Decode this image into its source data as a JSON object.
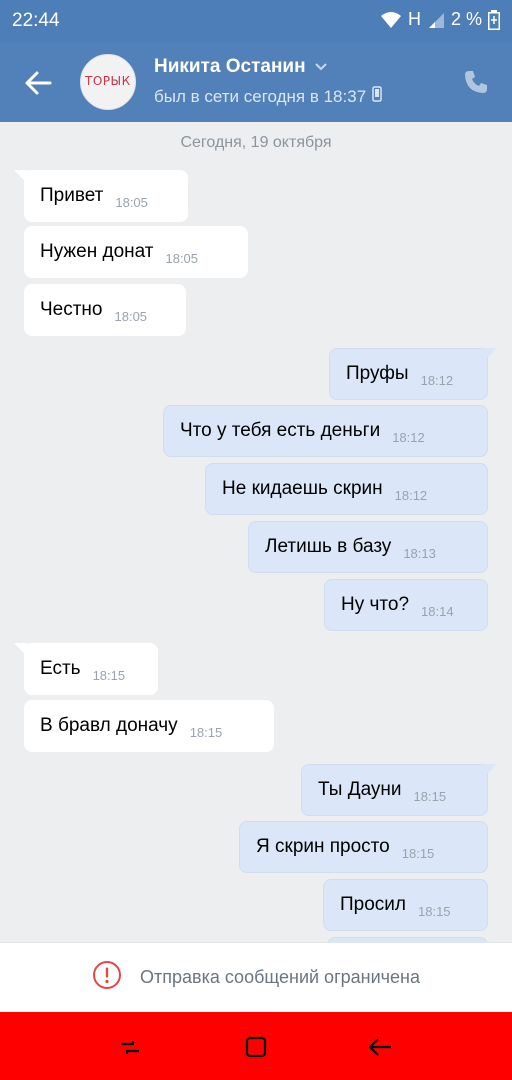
{
  "status_bar": {
    "time": "22:44",
    "network": "H",
    "battery": "2 %"
  },
  "header": {
    "name": "Никита Останин",
    "status": "был в сети сегодня в 18:37",
    "avatar_text": "ТОРЫК"
  },
  "chat": {
    "date": "Сегодня, 19 октября",
    "messages": [
      {
        "text": "Привет",
        "time": "18:05",
        "dir": "in"
      },
      {
        "text": "Нужен донат",
        "time": "18:05",
        "dir": "in"
      },
      {
        "text": "Честно",
        "time": "18:05",
        "dir": "in"
      },
      {
        "text": "Пруфы",
        "time": "18:12",
        "dir": "out"
      },
      {
        "text": "Что у тебя есть деньги",
        "time": "18:12",
        "dir": "out"
      },
      {
        "text": "Не кидаешь скрин",
        "time": "18:12",
        "dir": "out"
      },
      {
        "text": "Летишь в базу",
        "time": "18:13",
        "dir": "out"
      },
      {
        "text": "Ну что?",
        "time": "18:14",
        "dir": "out"
      },
      {
        "text": "Есть",
        "time": "18:15",
        "dir": "in"
      },
      {
        "text": "В бравл доначу",
        "time": "18:15",
        "dir": "in"
      },
      {
        "text": "Ты Дауни",
        "time": "18:15",
        "dir": "out"
      },
      {
        "text": "Я скрин просто",
        "time": "18:15",
        "dir": "out"
      },
      {
        "text": "Просил",
        "time": "18:15",
        "dir": "out"
      }
    ]
  },
  "restriction": {
    "text": "Отправка сообщений ограничена"
  },
  "colors": {
    "header": "#5181b8",
    "navbar": "#ff0000",
    "outgoing": "#dbe7f8"
  }
}
